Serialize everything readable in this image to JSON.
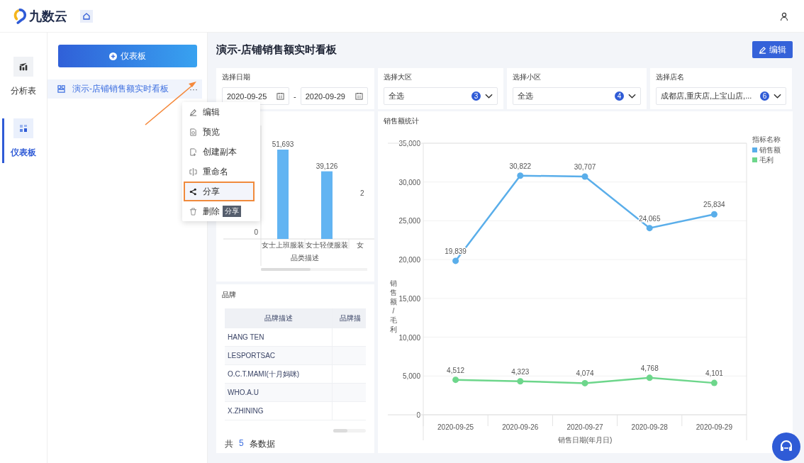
{
  "app": {
    "logo": "九数云"
  },
  "rail": [
    {
      "label": "分析表",
      "selected": false
    },
    {
      "label": "仪表板",
      "selected": true
    }
  ],
  "sidebar": {
    "new_button": "仪表板",
    "items": [
      {
        "label": "演示-店铺销售额实时看板",
        "more": "···",
        "selected": true
      }
    ]
  },
  "context_menu": {
    "items": [
      {
        "label": "编辑",
        "selected": false
      },
      {
        "label": "预览",
        "selected": false
      },
      {
        "label": "创建副本",
        "selected": false
      },
      {
        "label": "重命名",
        "selected": false
      },
      {
        "label": "分享",
        "selected": true
      },
      {
        "label": "删除",
        "selected": false
      }
    ],
    "tooltip": "分享"
  },
  "dashboard": {
    "title": "演示-店铺销售额实时看板",
    "edit_button": "编辑",
    "filters": [
      {
        "kind": "date_range",
        "label": "选择日期",
        "start": "2020-09-25",
        "separator": "-",
        "end": "2020-09-29"
      },
      {
        "kind": "select",
        "label": "选择大区",
        "value": "全选",
        "count": "3"
      },
      {
        "kind": "select",
        "label": "选择小区",
        "value": "全选",
        "count": "4"
      },
      {
        "kind": "select",
        "label": "选择店名",
        "value": "成都店,重庆店,上宝山店,...",
        "count": "6"
      }
    ],
    "category_chart": {
      "cut_label": "2",
      "zero_label": "0",
      "chart_data": {
        "type": "bar",
        "xlabel": "品类描述",
        "categories": [
          "女士上班服装",
          "女士轻便服装",
          "女"
        ],
        "values": [
          51693,
          39126,
          null
        ],
        "value_labels": [
          "51,693",
          "39,126",
          null
        ]
      }
    },
    "brand_table": {
      "title": "品牌",
      "columns": [
        "品牌描述",
        "品牌描"
      ],
      "rows": [
        "HANG TEN",
        "LESPORTSAC",
        "O.C.T.MAMI(十月妈咪)",
        "WHO.A.U",
        "X.ZHINING"
      ],
      "footer": {
        "prefix": "共",
        "count": "5",
        "suffix": "条数据"
      }
    },
    "sales_chart": {
      "title": "销售额统计",
      "legend_title": "指标名称",
      "chart_data": {
        "type": "line",
        "xlabel": "销售日期(年月日)",
        "ylabel": "销售额/毛利",
        "categories": [
          "2020-09-25",
          "2020-09-26",
          "2020-09-27",
          "2020-09-28",
          "2020-09-29"
        ],
        "series": [
          {
            "name": "销售额",
            "color": "#5aaeea",
            "marker": true,
            "values": [
              19839,
              30822,
              30707,
              24065,
              25834
            ],
            "value_labels": [
              "19,839",
              "30,822",
              "30,707",
              "24,065",
              "25,834"
            ]
          },
          {
            "name": "毛利",
            "color": "#6dd68b",
            "marker": true,
            "values": [
              4512,
              4323,
              4074,
              4768,
              4101
            ],
            "value_labels": [
              "4,512",
              "4,323",
              "4,074",
              "4,768",
              "4,101"
            ]
          }
        ],
        "ylim": [
          0,
          35000
        ],
        "yticks": [
          {
            "value": 0,
            "label": "0"
          },
          {
            "value": 5000,
            "label": "5,000"
          },
          {
            "value": 10000,
            "label": "10,000"
          },
          {
            "value": 15000,
            "label": "15,000"
          },
          {
            "value": 20000,
            "label": "20,000"
          },
          {
            "value": 25000,
            "label": "25,000"
          },
          {
            "value": 30000,
            "label": "30,000"
          },
          {
            "value": 35000,
            "label": "35,000"
          }
        ],
        "grid": true,
        "legend": "right"
      }
    }
  }
}
